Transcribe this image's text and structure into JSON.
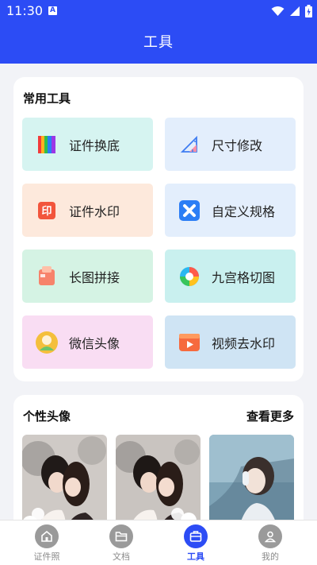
{
  "status_bar": {
    "time": "11:30",
    "indicator": "A"
  },
  "app_bar": {
    "title": "工具"
  },
  "tools_section": {
    "title": "常用工具",
    "items": [
      {
        "label": "证件换底",
        "icon": "color-swatch-icon",
        "bg": "#d6f4f1"
      },
      {
        "label": "尺寸修改",
        "icon": "ruler-icon",
        "bg": "#e3eefc"
      },
      {
        "label": "证件水印",
        "icon": "stamp-icon",
        "bg": "#fde9dc"
      },
      {
        "label": "自定义规格",
        "icon": "custom-spec-icon",
        "bg": "#e3eefc"
      },
      {
        "label": "长图拼接",
        "icon": "long-image-icon",
        "bg": "#d5f3e4"
      },
      {
        "label": "九宫格切图",
        "icon": "aperture-icon",
        "bg": "#c9f0ef"
      },
      {
        "label": "微信头像",
        "icon": "avatar-icon",
        "bg": "#f9ddf3"
      },
      {
        "label": "视频去水印",
        "icon": "video-icon",
        "bg": "#cfe4f4"
      }
    ]
  },
  "avatar_section": {
    "title": "个性头像",
    "more_label": "查看更多",
    "photos": [
      "avatar-photo-couple-1",
      "avatar-photo-couple-2",
      "avatar-photo-girl-headphones"
    ]
  },
  "tab_bar": {
    "tabs": [
      {
        "label": "证件照",
        "icon": "home-icon",
        "active": false
      },
      {
        "label": "文档",
        "icon": "folder-icon",
        "active": false
      },
      {
        "label": "工具",
        "icon": "toolbox-icon",
        "active": true
      },
      {
        "label": "我的",
        "icon": "user-icon",
        "active": false
      }
    ]
  },
  "colors": {
    "primary": "#2c4cf5",
    "background": "#f2f3f7"
  }
}
